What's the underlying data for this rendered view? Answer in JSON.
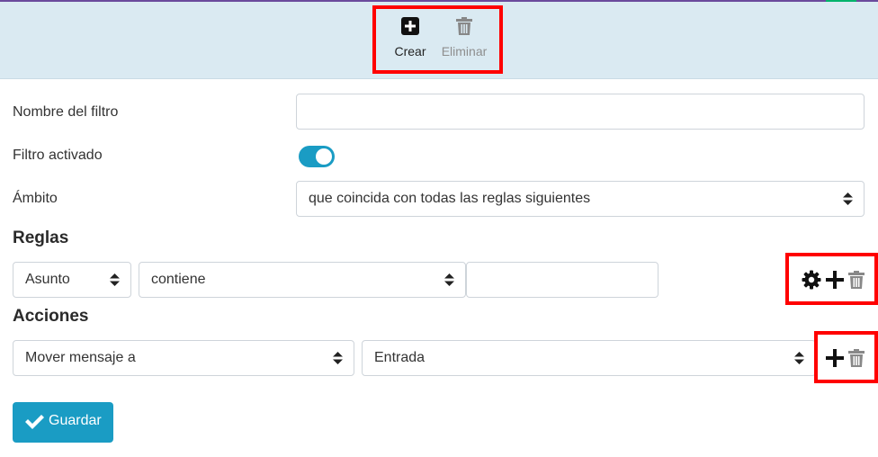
{
  "toolbar": {
    "create_label": "Crear",
    "delete_label": "Eliminar"
  },
  "form": {
    "name_label": "Nombre del filtro",
    "name_value": "",
    "enabled_label": "Filtro activado",
    "enabled": true,
    "scope_label": "Ámbito",
    "scope_value": "que coincida con todas las reglas siguientes"
  },
  "rules": {
    "heading": "Reglas",
    "field_value": "Asunto",
    "operator_value": "contiene",
    "text_value": ""
  },
  "actions": {
    "heading": "Acciones",
    "action_value": "Mover mensaje a",
    "target_value": "Entrada"
  },
  "save_label": "Guardar",
  "colors": {
    "accent": "#1a9cc4",
    "toolbar_bg": "#daeaf2",
    "highlight": "#ff0000"
  },
  "icons": [
    "plus-square-icon",
    "trash-icon",
    "gear-icon",
    "plus-icon",
    "check-icon",
    "select-arrows-icon"
  ]
}
